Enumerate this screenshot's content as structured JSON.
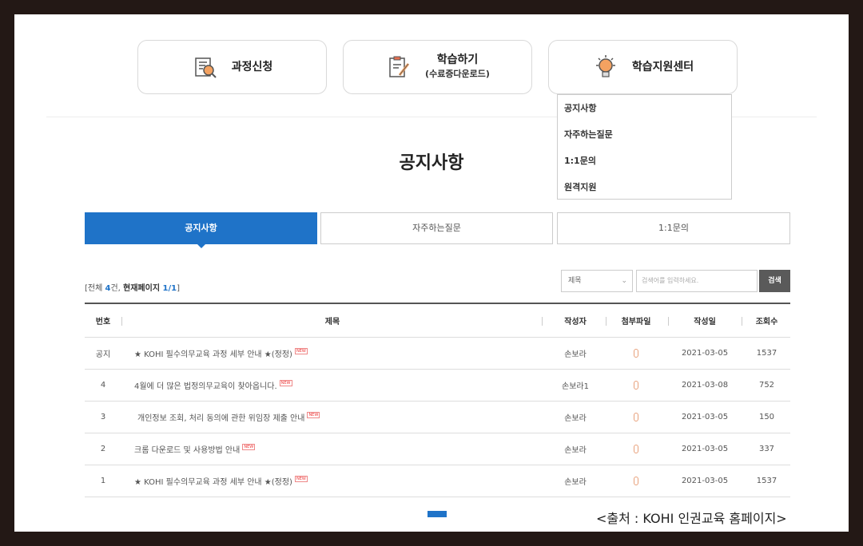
{
  "menu": [
    {
      "label": "과정신청",
      "sub": "",
      "icon": "document-search-icon"
    },
    {
      "label": "학습하기",
      "sub": "(수료증다운로드)",
      "icon": "clipboard-pencil-icon"
    },
    {
      "label": "학습지원센터",
      "sub": "",
      "icon": "lightbulb-icon"
    }
  ],
  "dropdown": [
    "공지사항",
    "자주하는질문",
    "1:1문의",
    "원격지원"
  ],
  "page_title": "공지사항",
  "tabs": [
    "공지사항",
    "자주하는질문",
    "1:1문의"
  ],
  "summary": {
    "prefix": "[전체 ",
    "total": "4",
    "mid": "건, ",
    "current_label": "현재페이지 ",
    "current": "1/1",
    "suffix": "]"
  },
  "search": {
    "select": "제목",
    "placeholder": "검색어를 입력하세요.",
    "button": "검색"
  },
  "table": {
    "headers": [
      "번호",
      "제목",
      "작성자",
      "첨부파일",
      "작성일",
      "조회수"
    ],
    "new_badge": "NEW",
    "rows": [
      {
        "no": "공지",
        "title": "★ KOHI 필수의무교육 과정 세부 안내 ★(정정)",
        "author": "손보라",
        "date": "2021-03-05",
        "views": "1537"
      },
      {
        "no": "4",
        "title": "4월에 더 많은 법정의무교육이 찾아옵니다.",
        "author": "손보라1",
        "date": "2021-03-08",
        "views": "752"
      },
      {
        "no": "3",
        "title": "개인정보 조회, 처리 동의에 관한 위임장 제출 안내",
        "author": "손보라",
        "date": "2021-03-05",
        "views": "150"
      },
      {
        "no": "2",
        "title": "크롬 다운로드 및 사용방법 안내",
        "author": "손보라",
        "date": "2021-03-05",
        "views": "337"
      },
      {
        "no": "1",
        "title": "★ KOHI 필수의무교육 과정 세부 안내 ★(정정)",
        "author": "손보라",
        "date": "2021-03-05",
        "views": "1537"
      }
    ]
  },
  "caption": "<출처 : KOHI 인권교육  홈페이지>",
  "colors": {
    "accent": "#1f73c8",
    "frame": "#231815",
    "search_button": "#5a5a5a",
    "new_badge": "#e33333"
  }
}
